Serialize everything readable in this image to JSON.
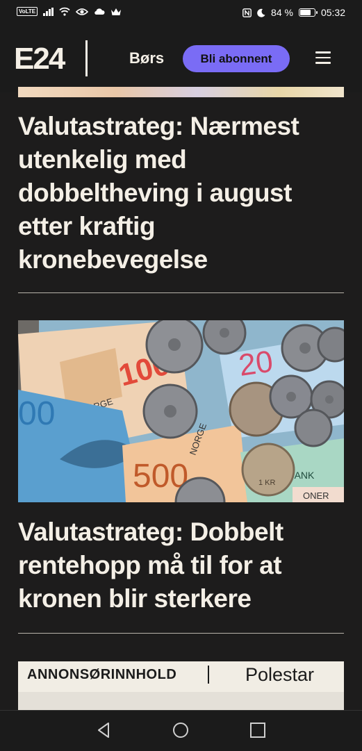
{
  "status_bar": {
    "volte": "VoLTE",
    "battery_percent": "84 %",
    "battery_level": 0.84,
    "time": "05:32",
    "icons": [
      "signal-icon",
      "wifi-icon",
      "eye-icon",
      "cloud-icon",
      "crown-icon",
      "nfc-icon",
      "moon-icon",
      "battery-icon"
    ]
  },
  "header": {
    "logo": "E24",
    "nav_link": "Børs",
    "subscribe_label": "Bli abonnent",
    "menu_icon": "hamburger-menu-icon"
  },
  "articles": [
    {
      "headline_lines": [
        "Valutastrateg: Nærmest",
        "utenkelig med",
        "dobbeltheving i august",
        "etter kraftig",
        "kronebevegelse"
      ]
    },
    {
      "image_labels": {
        "note_100": "100",
        "norge_1": "NORGE",
        "note_20": "20",
        "note_500": "500",
        "norge_2": "NORGE",
        "bank": "S BANK",
        "kroner": "ONER",
        "edge_00": "00",
        "coin": "1 KR"
      },
      "headline_lines": [
        "Valutastrateg: Dobbelt",
        "rentehopp må til for at",
        "kronen blir sterkere"
      ]
    }
  ],
  "ad": {
    "label": "ANNONSØRINNHOLD",
    "brand": "Polestar"
  },
  "nav_bar": {
    "icons": [
      "back-icon",
      "home-icon",
      "recents-icon"
    ]
  },
  "colors": {
    "background": "#1d1c1c",
    "text": "#f4efe6",
    "accent": "#7a6cf5"
  }
}
